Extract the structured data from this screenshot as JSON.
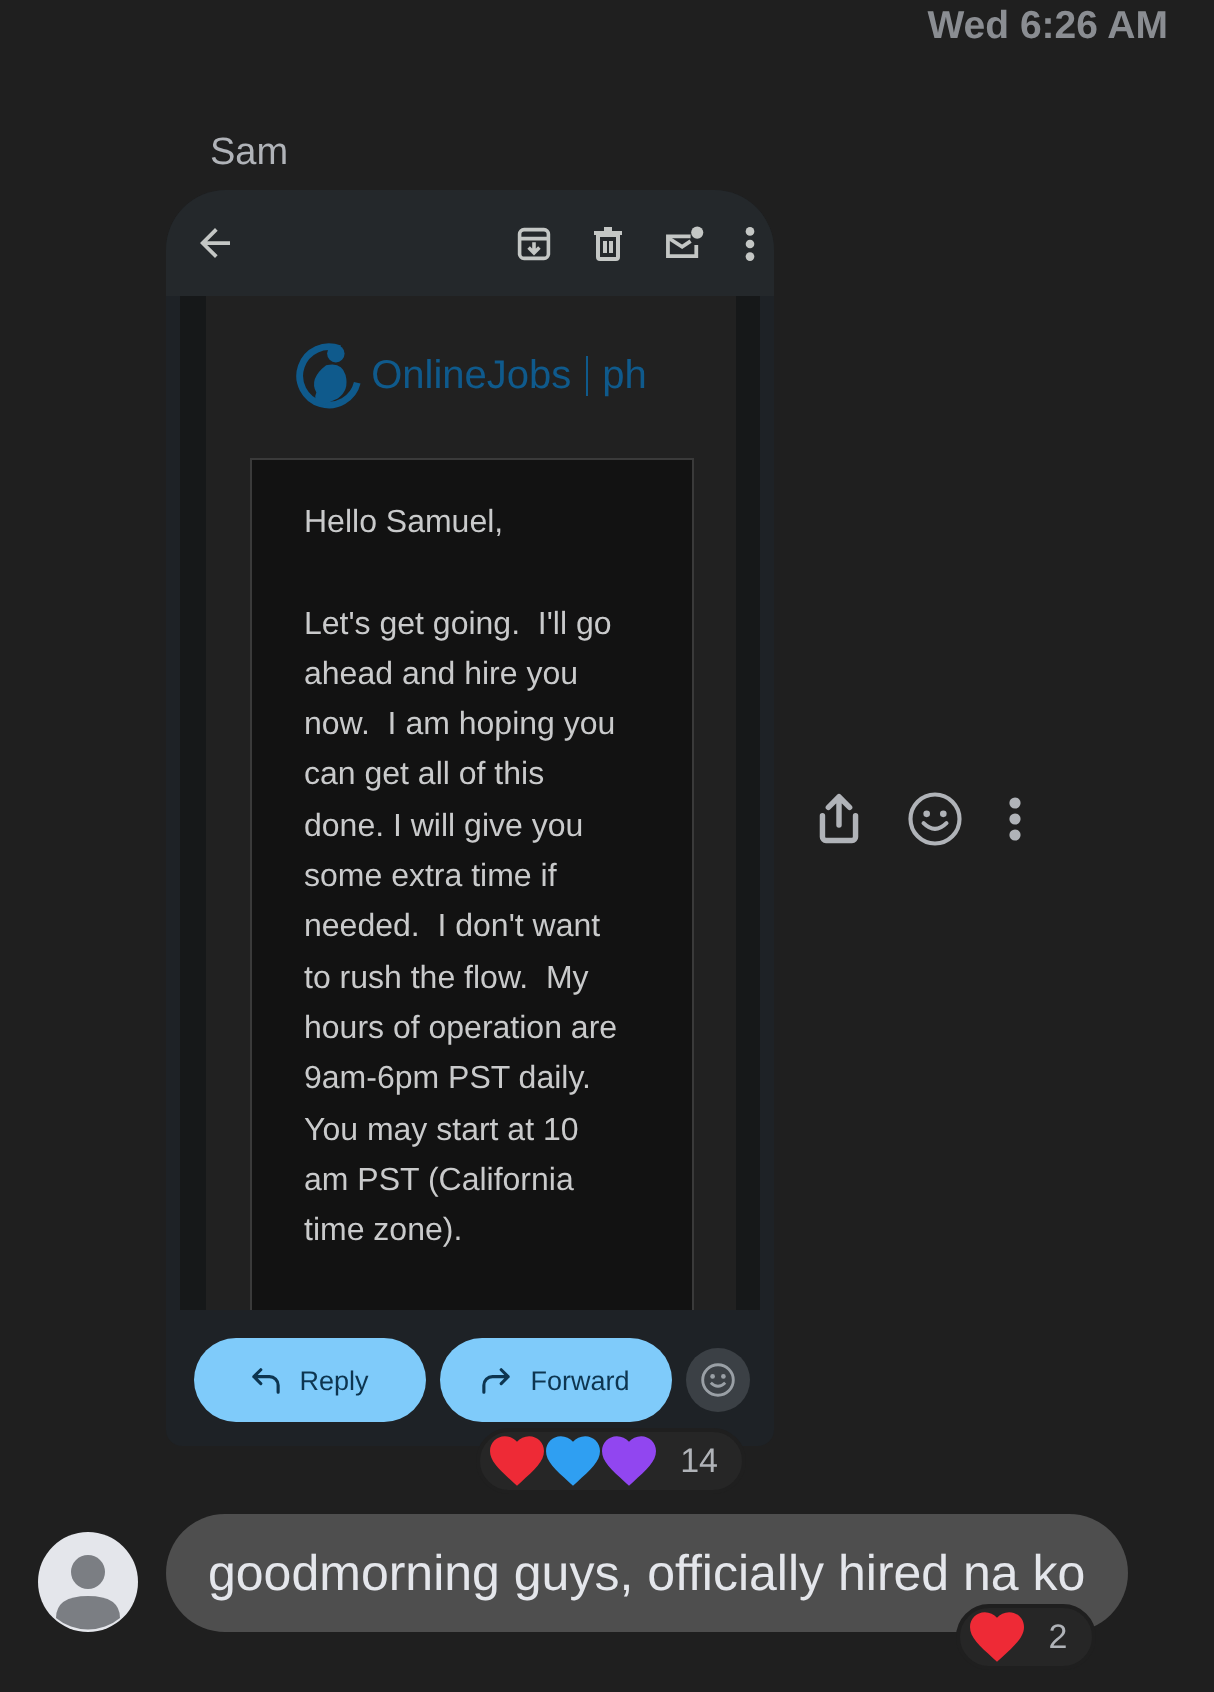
{
  "timestamp": "Wed 6:26 AM",
  "messages": [
    {
      "kind": "image",
      "sender": "Sam",
      "image": {
        "logo": {
          "name": "OnlineJobs",
          "suffix": "ph"
        },
        "body": [
          "Hello Samuel,",
          "Let's get going.  I'll go ahead and hire you now.  I am hoping you can get all of this done. I will give you some extra time if needed.  I don't want to rush the flow.  My hours of operation are 9am-6pm PST daily. You may start at 10 am PST (California time zone)."
        ],
        "actions": [
          {
            "kind": "reply",
            "label": "Reply"
          },
          {
            "kind": "forward",
            "label": "Forward"
          }
        ]
      },
      "reactions": {
        "emojis": [
          {
            "color": "#ee2a36"
          },
          {
            "color": "#2f9ff2"
          },
          {
            "color": "#9146f0"
          }
        ],
        "count": "14"
      }
    },
    {
      "kind": "text",
      "text": "goodmorning guys, officially hired na ko",
      "reactions": {
        "emojis": [
          {
            "color": "#ee2a36"
          }
        ],
        "count": "2"
      }
    }
  ]
}
